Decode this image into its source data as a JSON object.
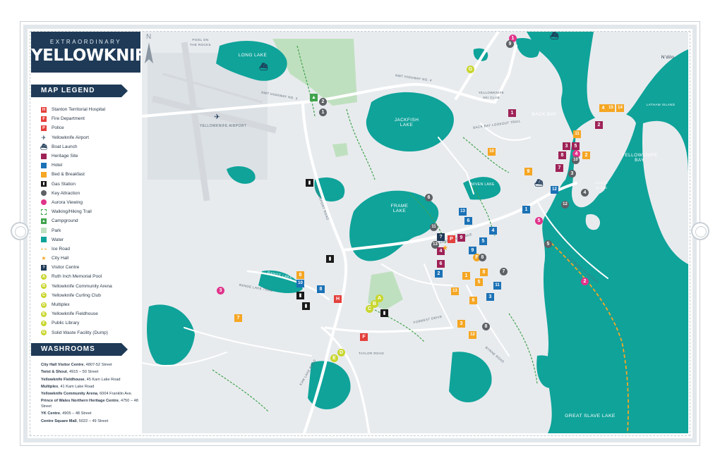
{
  "brand": {
    "tagline": "EXTRAORDINARY",
    "name": "YELLOWKNIFE"
  },
  "legend": {
    "title": "MAP LEGEND",
    "items": [
      {
        "label": "Stanton Territorial Hospital",
        "icon": "hospital-icon",
        "color": "#e4403b",
        "glyph": "H",
        "shape": "square"
      },
      {
        "label": "Fire Department",
        "icon": "fire-department-icon",
        "color": "#e4403b",
        "glyph": "F",
        "shape": "square"
      },
      {
        "label": "Police",
        "icon": "police-icon",
        "color": "#e4403b",
        "glyph": "P",
        "shape": "square"
      },
      {
        "label": "Yellowknife Airport",
        "icon": "airplane-icon",
        "color": "#1e3a57",
        "glyph": "✈",
        "shape": "plain"
      },
      {
        "label": "Boat Launch",
        "icon": "boat-icon",
        "color": "#1e3a57",
        "glyph": "⛴",
        "shape": "plain"
      },
      {
        "label": "Heritage Site",
        "icon": "heritage-site-icon",
        "color": "#9e2257",
        "glyph": "",
        "shape": "square"
      },
      {
        "label": "Hotel",
        "icon": "hotel-icon",
        "color": "#1b72b6",
        "glyph": "",
        "shape": "square"
      },
      {
        "label": "Bed & Breakfast",
        "icon": "bed-and-breakfast-icon",
        "color": "#f5a623",
        "glyph": "",
        "shape": "square"
      },
      {
        "label": "Gas Station",
        "icon": "gas-station-icon",
        "color": "#1a1a1a",
        "glyph": "▮",
        "shape": "square"
      },
      {
        "label": "Key Attraction",
        "icon": "key-attraction-icon",
        "color": "#5d6166",
        "glyph": "",
        "shape": "circle"
      },
      {
        "label": "Aurora Viewing",
        "icon": "aurora-viewing-icon",
        "color": "#e0338a",
        "glyph": "",
        "shape": "circle"
      },
      {
        "label": "Walking/Hiking Trail",
        "icon": "trail-icon",
        "color": "#3fa34d",
        "glyph": "",
        "shape": "dashed"
      },
      {
        "label": "Campground",
        "icon": "campground-icon",
        "color": "#3fa34d",
        "glyph": "▲",
        "shape": "square"
      },
      {
        "label": "Park",
        "icon": "park-icon",
        "color": "#bfe0bf",
        "glyph": "",
        "shape": "square"
      },
      {
        "label": "Water",
        "icon": "water-icon",
        "color": "#0fa39a",
        "glyph": "",
        "shape": "square"
      },
      {
        "label": "Ice Road",
        "icon": "ice-road-icon",
        "color": "#f5a623",
        "glyph": "",
        "shape": "line"
      },
      {
        "label": "City Hall",
        "icon": "city-hall-star-icon",
        "color": "#f5a623",
        "glyph": "★",
        "shape": "plain"
      },
      {
        "label": "Visitor Centre",
        "icon": "visitor-centre-icon",
        "color": "#1e3a57",
        "glyph": "?",
        "shape": "square"
      },
      {
        "label": "Ruth Inch Memorial Pool",
        "icon": "pool-icon",
        "color": "#c8d62b",
        "glyph": "A",
        "shape": "circle"
      },
      {
        "label": "Yellowknife Community Arena",
        "icon": "arena-icon",
        "color": "#c8d62b",
        "glyph": "B",
        "shape": "circle"
      },
      {
        "label": "Yellowknife Curling Club",
        "icon": "curling-club-icon",
        "color": "#c8d62b",
        "glyph": "C",
        "shape": "circle"
      },
      {
        "label": "Multiplex",
        "icon": "multiplex-icon",
        "color": "#c8d62b",
        "glyph": "D",
        "shape": "circle"
      },
      {
        "label": "Yellowknife Fieldhouse",
        "icon": "fieldhouse-icon",
        "color": "#c8d62b",
        "glyph": "E",
        "shape": "circle"
      },
      {
        "label": "Public Library",
        "icon": "library-icon",
        "color": "#c8d62b",
        "glyph": "F",
        "shape": "circle"
      },
      {
        "label": "Solid Waste Facility (Dump)",
        "icon": "dump-icon",
        "color": "#c8d62b",
        "glyph": "G",
        "shape": "circle"
      }
    ]
  },
  "washrooms": {
    "title": "WASHROOMS",
    "items": [
      {
        "name": "City Hall Visitor Centre",
        "address": ", 4807-52 Street"
      },
      {
        "name": "Twist & Shout",
        "address": ", 4915 – 50 Street"
      },
      {
        "name": "Yellowknife Fieldhouse",
        "address": ", 45 Kam Lake Road"
      },
      {
        "name": "Multiplex",
        "address": ", 41 Kam Lake Road"
      },
      {
        "name": "Yellowknife Community Arena",
        "address": ", 6004 Franklin Ave."
      },
      {
        "name": "Prince of Wales Northern Heritage Centre",
        "address": ", 4750 – 48 Street"
      },
      {
        "name": "YK Centre",
        "address": ", 4905 – 48 Street"
      },
      {
        "name": "Centre Square Mall",
        "address": ", 5022 – 49 Street"
      }
    ]
  },
  "map_labels": {
    "long_lake": "LONG LAKE",
    "jackfish_lake": "JACKFISH\nLAKE",
    "frame_lake": "FRAME\nLAKE",
    "niven_lake": "NIVEN LAKE",
    "range_lake": "RANGE LAKE",
    "back_bay": "BACK BAY",
    "yellowknife_bay": "YELLOWKNIFE\nBAY",
    "great_slave_lake": "GREAT SLAVE LAKE",
    "ndilo": "N'dilo",
    "airport": "YELLOWKNIFE AIRPORT",
    "ski_club": "YELLOWKNIFE\nSKI CLUB",
    "latham_island": "LATHAM ISLAND",
    "joliffe_island": "JOLIFFE\nISLAND",
    "pool_on_rocks": "POOL ON\nTHE ROCKS",
    "hwy3": "NWT HIGHWAY NO. 3",
    "hwy4": "NWT HIGHWAY NO. 4",
    "ice_road": "ICE ROAD TO DETTAH",
    "range_lake_trail": "RANGE LAKE TRAIL",
    "old_airport_road": "OLD AIRPORT ROAD",
    "franklin_ave": "FRANKLIN AVENUE",
    "taylor_road": "TAYLOR ROAD",
    "kam_lake_road": "KAM LAKE ROAD",
    "back_bay_lookout": "BACK BAY LOOKOUT TRAIL",
    "forrest_drive": "FORREST DRIVE",
    "byrne_road": "BYRNE ROAD"
  },
  "colors": {
    "water": "#0fa39a",
    "land": "#e8ebee",
    "park": "#bfe0bf",
    "navy": "#1e3a57",
    "heritage": "#9e2257",
    "hotel": "#1b72b6",
    "bnb": "#f5a623",
    "attraction": "#5d6166",
    "aurora": "#e0338a",
    "red": "#e4403b",
    "recreation": "#c8d62b"
  }
}
